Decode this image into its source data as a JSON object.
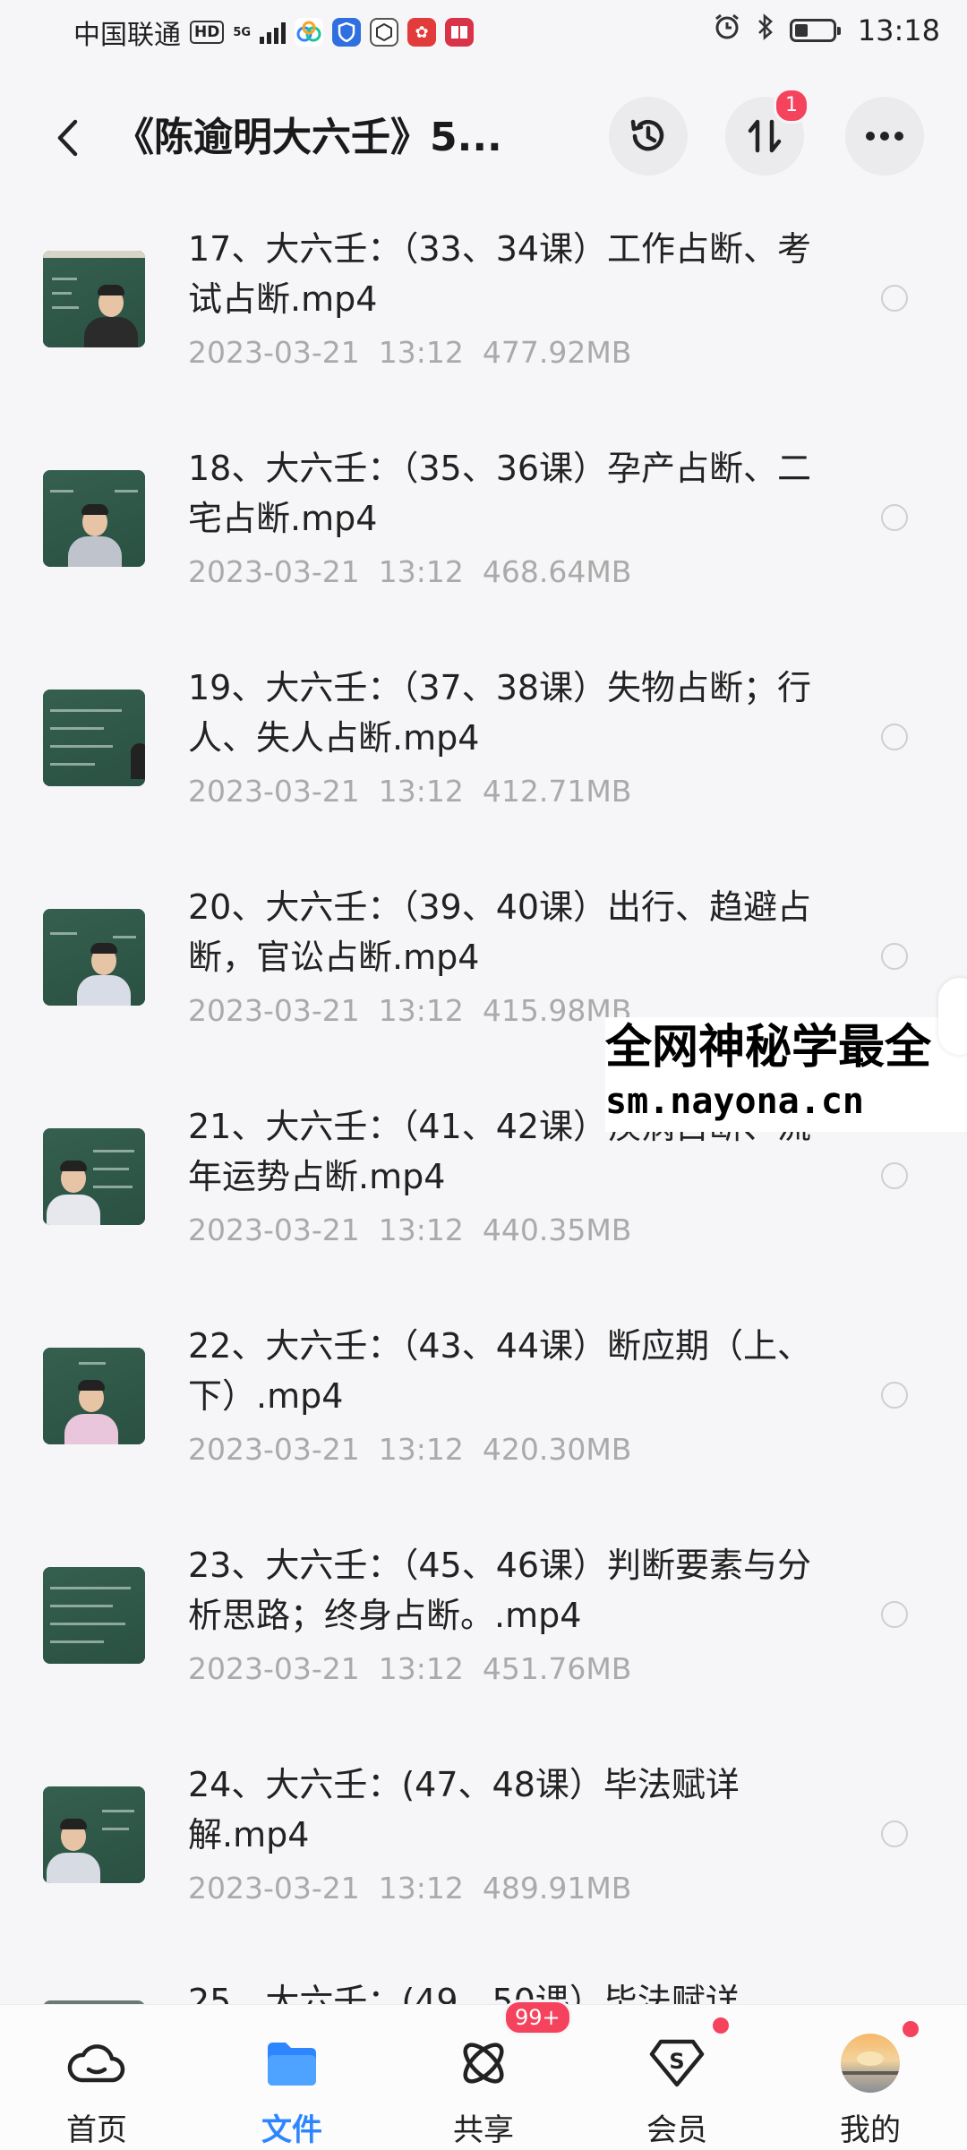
{
  "status_bar": {
    "carrier": "中国联通",
    "hd": "HD",
    "network": "5G",
    "time": "13:18"
  },
  "header": {
    "title": "《陈逾明大六壬》5...",
    "transfer_badge": "1"
  },
  "files": [
    {
      "name": "17、大六壬：（33、34课）工作占断、考试占断.mp4",
      "date": "2023-03-21",
      "time": "13:12",
      "size": "477.92MB"
    },
    {
      "name": "18、大六壬：（35、36课）孕产占断、二宅占断.mp4",
      "date": "2023-03-21",
      "time": "13:12",
      "size": "468.64MB"
    },
    {
      "name": "19、大六壬：（37、38课）失物占断；行人、失人占断.mp4",
      "date": "2023-03-21",
      "time": "13:12",
      "size": "412.71MB"
    },
    {
      "name": "20、大六壬：（39、40课）出行、趋避占断，官讼占断.mp4",
      "date": "2023-03-21",
      "time": "13:12",
      "size": "415.98MB"
    },
    {
      "name": "21、大六壬：（41、42课）疾病占断、流年运势占断.mp4",
      "date": "2023-03-21",
      "time": "13:12",
      "size": "440.35MB"
    },
    {
      "name": "22、大六壬：（43、44课）断应期（上、下）.mp4",
      "date": "2023-03-21",
      "time": "13:12",
      "size": "420.30MB"
    },
    {
      "name": "23、大六壬：（45、46课）判断要素与分析思路；终身占断。.mp4",
      "date": "2023-03-21",
      "time": "13:12",
      "size": "451.76MB"
    },
    {
      "name": "24、大六壬：(47、48课）毕法赋详解.mp4",
      "date": "2023-03-21",
      "time": "13:12",
      "size": "489.91MB"
    }
  ],
  "partial_item": "25、大六壬：(49、50课）毕法赋详",
  "watermark": {
    "line1": "全网神秘学最全",
    "line2": "sm.nayona.cn"
  },
  "bottom_nav": {
    "home": "首页",
    "files": "文件",
    "share": "共享",
    "share_badge": "99+",
    "member": "会员",
    "mine": "我的"
  },
  "colors": {
    "accent": "#2e86ff",
    "badge": "#f5425d",
    "background": "#f6f6f8"
  }
}
